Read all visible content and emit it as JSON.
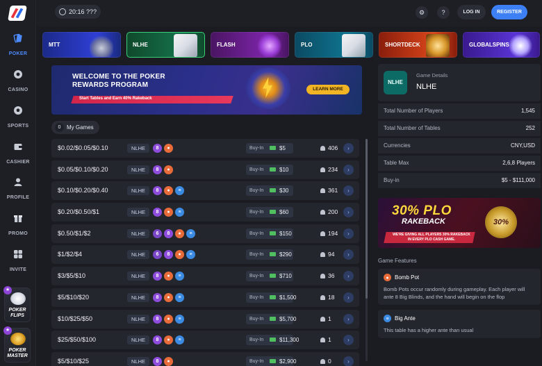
{
  "topbar": {
    "clock": "20:16 ???",
    "login_label": "LOG IN",
    "register_label": "REGISTER",
    "settings_icon": "gear-icon",
    "help_icon": "question-icon"
  },
  "rail": {
    "items": [
      {
        "label": "POKER",
        "icon": "poker-icon"
      },
      {
        "label": "CASINO",
        "icon": "casino-chip-icon"
      },
      {
        "label": "SPORTS",
        "icon": "soccer-ball-icon"
      },
      {
        "label": "CASHIER",
        "icon": "wallet-icon"
      },
      {
        "label": "PROFILE",
        "icon": "user-icon"
      },
      {
        "label": "PROMO",
        "icon": "gift-icon"
      },
      {
        "label": "INVITE",
        "icon": "invite-icon"
      }
    ],
    "games": [
      {
        "label": "POKER FLIPS",
        "line1": "POKER",
        "line2": "FLIPS"
      },
      {
        "label": "POKER MASTER",
        "line1": "POKER",
        "line2": "MASTER"
      }
    ]
  },
  "tabs": [
    {
      "label": "MTT",
      "line1": "MTT",
      "line2": ""
    },
    {
      "label": "NLHE",
      "line1": "NLHE",
      "line2": ""
    },
    {
      "label": "FLASH",
      "line1": "FLASH",
      "line2": ""
    },
    {
      "label": "PLO",
      "line1": "PLO",
      "line2": ""
    },
    {
      "label": "SHORT DECK",
      "line1": "SHORT",
      "line2": "DECK"
    },
    {
      "label": "GLOBAL SPINS",
      "line1": "GLOBAL",
      "line2": "SPINS"
    }
  ],
  "banner": {
    "title_line1": "WELCOME TO THE POKER",
    "title_line2": "REWARDS PROGRAM",
    "subtitle": "Start Tables and Earn 40% Rakeback",
    "cta": "LEARN MORE"
  },
  "my_games": {
    "count": "0",
    "label": "My Games"
  },
  "table_rows": [
    {
      "stakes": "$0.02/$0.05/$0.10",
      "game": "NLHE",
      "chips": [
        "8",
        "bomb"
      ],
      "buyin_label": "Buy-In",
      "buyin": "$5",
      "players": "406"
    },
    {
      "stakes": "$0.05/$0.10/$0.20",
      "game": "NLHE",
      "chips": [
        "8",
        "bomb"
      ],
      "buyin_label": "Buy-In",
      "buyin": "$10",
      "players": "234"
    },
    {
      "stakes": "$0.10/$0.20/$0.40",
      "game": "NLHE",
      "chips": [
        "8",
        "bomb",
        "ante"
      ],
      "buyin_label": "Buy-In",
      "buyin": "$30",
      "players": "361"
    },
    {
      "stakes": "$0.20/$0.50/$1",
      "game": "NLHE",
      "chips": [
        "8",
        "bomb",
        "ante"
      ],
      "buyin_label": "Buy-In",
      "buyin": "$60",
      "players": "200"
    },
    {
      "stakes": "$0.50/$1/$2",
      "game": "NLHE",
      "chips": [
        "6",
        "8",
        "bomb",
        "ante"
      ],
      "buyin_label": "Buy-In",
      "buyin": "$150",
      "players": "194"
    },
    {
      "stakes": "$1/$2/$4",
      "game": "NLHE",
      "chips": [
        "6",
        "8",
        "bomb",
        "ante"
      ],
      "buyin_label": "Buy-In",
      "buyin": "$290",
      "players": "94"
    },
    {
      "stakes": "$3/$5/$10",
      "game": "NLHE",
      "chips": [
        "8",
        "bomb",
        "ante"
      ],
      "buyin_label": "Buy-In",
      "buyin": "$710",
      "players": "36"
    },
    {
      "stakes": "$5/$10/$20",
      "game": "NLHE",
      "chips": [
        "8",
        "bomb",
        "ante"
      ],
      "buyin_label": "Buy-In",
      "buyin": "$1,500",
      "players": "18"
    },
    {
      "stakes": "$10/$25/$50",
      "game": "NLHE",
      "chips": [
        "8",
        "bomb",
        "ante"
      ],
      "buyin_label": "Buy-In",
      "buyin": "$5,700",
      "players": "1"
    },
    {
      "stakes": "$25/$50/$100",
      "game": "NLHE",
      "chips": [
        "8",
        "bomb",
        "ante"
      ],
      "buyin_label": "Buy-In",
      "buyin": "$11,300",
      "players": "1"
    },
    {
      "stakes": "$5/$10/$25",
      "game": "NLHE",
      "chips": [
        "8",
        "bomb"
      ],
      "buyin_label": "Buy-In",
      "buyin": "$2,900",
      "players": "0"
    }
  ],
  "details": {
    "icon_text": "NLHE",
    "subtitle": "Game Details",
    "title": "NLHE",
    "stats": [
      {
        "key": "Total Number of Players",
        "value": "1,545"
      },
      {
        "key": "Total Number of Tables",
        "value": "252"
      },
      {
        "key": "Currencies",
        "value": "CNY,USD"
      },
      {
        "key": "Table Max",
        "value": "2,6,8 Players"
      },
      {
        "key": "Buy-in",
        "value": "$5 - $111,000"
      }
    ]
  },
  "promo": {
    "big": "30% PLO",
    "mid": "RAKEBACK",
    "small": "WE'RE GIVING ALL PLAYERS 30% RAKEBACK IN EVERY PLO CASH GAME.",
    "coin": "30%"
  },
  "features": {
    "title": "Game Features",
    "items": [
      {
        "name": "Bomb Pot",
        "icon": "bomb-icon",
        "desc": "Bomb Pots occur randomly during gameplay. Each player will ante 8 Big Blinds, and the hand will begin on the flop"
      },
      {
        "name": "Big Ante",
        "icon": "ante-icon",
        "desc": "This table has a higher ante than usual"
      }
    ]
  },
  "colors": {
    "accent": "#3d80f5",
    "bomb": "#e86b3a",
    "ante": "#3b8be2",
    "seat8": "#8d4cdc",
    "cash": "#4fbf5f"
  }
}
